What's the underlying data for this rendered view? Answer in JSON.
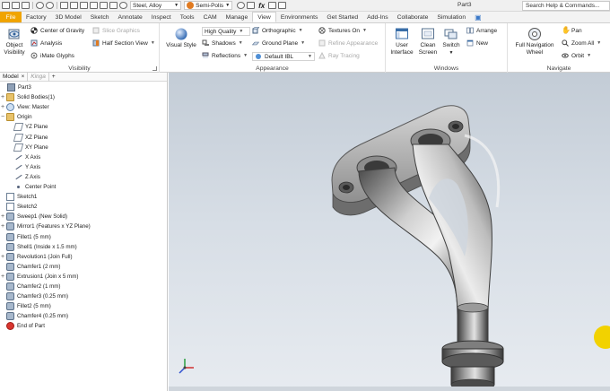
{
  "titlebar": {
    "material": "Steel, Alloy",
    "material_color": "#9aa3ad",
    "appearance": "Semi-Polis",
    "appearance_color": "#e07b22",
    "document_title": "Part3",
    "search_placeholder": "Search Help & Commands..."
  },
  "tabs": [
    "File",
    "Factory",
    "3D Model",
    "Sketch",
    "Annotate",
    "Inspect",
    "Tools",
    "CAM",
    "Manage",
    "View",
    "Environments",
    "Get Started",
    "Add-Ins",
    "Collaborate",
    "Simulation"
  ],
  "active_tab": "View",
  "ribbon": {
    "visibility": {
      "title": "Visibility",
      "object_visibility": "Object Visibility",
      "center_of_gravity": "Center of Gravity",
      "slice_graphics": "Slice Graphics",
      "analysis": "Analysis",
      "half_section_view": "Half Section View",
      "imate_glyphs": "iMate Glyphs"
    },
    "appearance": {
      "title": "Appearance",
      "visual_style": "Visual Style",
      "high_quality": "High Quality",
      "shadows": "Shadows",
      "reflections": "Reflections",
      "orthographic": "Orthographic",
      "ground_plane": "Ground Plane",
      "default_ibl": "Default IBL",
      "textures_on": "Textures On",
      "refine_appearance": "Refine Appearance",
      "ray_tracing": "Ray Tracing"
    },
    "windows": {
      "title": "Windows",
      "user_interface": "User Interface",
      "clean_screen": "Clean Screen",
      "switch": "Switch",
      "arrange": "Arrange",
      "new": "New"
    },
    "navigate": {
      "title": "Navigate",
      "full_navigation_wheel": "Full Navigation Wheel",
      "pan": "Pan",
      "zoom_all": "Zoom All",
      "orbit": "Orbit"
    }
  },
  "browser": {
    "tabs": [
      "Model",
      "Kinga"
    ],
    "plus": "+",
    "items": [
      {
        "label": "Part3",
        "icon": "part-icon",
        "level": 0,
        "expander": ""
      },
      {
        "label": "Solid Bodies(1)",
        "icon": "folder-icon",
        "level": 1,
        "expander": "+"
      },
      {
        "label": "View: Master",
        "icon": "view-icon",
        "level": 1,
        "expander": "+"
      },
      {
        "label": "Origin",
        "icon": "folder-icon",
        "level": 1,
        "expander": "−"
      },
      {
        "label": "YZ Plane",
        "icon": "plane-icon",
        "level": 2,
        "expander": ""
      },
      {
        "label": "XZ Plane",
        "icon": "plane-icon",
        "level": 2,
        "expander": ""
      },
      {
        "label": "XY Plane",
        "icon": "plane-icon",
        "level": 2,
        "expander": ""
      },
      {
        "label": "X Axis",
        "icon": "axis-icon",
        "level": 2,
        "expander": ""
      },
      {
        "label": "Y Axis",
        "icon": "axis-icon",
        "level": 2,
        "expander": ""
      },
      {
        "label": "Z Axis",
        "icon": "axis-icon",
        "level": 2,
        "expander": ""
      },
      {
        "label": "Center Point",
        "icon": "point-icon",
        "level": 2,
        "expander": ""
      },
      {
        "label": "Sketch1",
        "icon": "sketch-icon",
        "level": 1,
        "expander": ""
      },
      {
        "label": "Sketch2",
        "icon": "sketch-icon",
        "level": 1,
        "expander": ""
      },
      {
        "label": "Sweep1 (New Solid)",
        "icon": "sweep-icon",
        "level": 1,
        "expander": "+"
      },
      {
        "label": "Mirror1 (Features x YZ Plane)",
        "icon": "mirror-icon",
        "level": 1,
        "expander": "+"
      },
      {
        "label": "Fillet1 (5 mm)",
        "icon": "fillet-icon",
        "level": 1,
        "expander": ""
      },
      {
        "label": "Shell1 (Inside x 1.5 mm)",
        "icon": "shell-icon",
        "level": 1,
        "expander": ""
      },
      {
        "label": "Revolution1 (Join Full)",
        "icon": "revolve-icon",
        "level": 1,
        "expander": "+"
      },
      {
        "label": "Chamfer1 (2 mm)",
        "icon": "chamfer-icon",
        "level": 1,
        "expander": ""
      },
      {
        "label": "Extrusion1 (Join x 5 mm)",
        "icon": "extrude-icon",
        "level": 1,
        "expander": "+"
      },
      {
        "label": "Chamfer2 (1 mm)",
        "icon": "chamfer-icon",
        "level": 1,
        "expander": ""
      },
      {
        "label": "Chamfer3 (0.25 mm)",
        "icon": "chamfer-icon",
        "level": 1,
        "expander": ""
      },
      {
        "label": "Fillet2 (5 mm)",
        "icon": "fillet-icon",
        "level": 1,
        "expander": ""
      },
      {
        "label": "Chamfer4 (0.25 mm)",
        "icon": "chamfer-icon",
        "level": 1,
        "expander": ""
      },
      {
        "label": "End of Part",
        "icon": "end-of-part-icon",
        "level": 1,
        "expander": ""
      }
    ]
  },
  "colors": {
    "file_tab": "#f0a400",
    "viewport_top": "#c3ccd6",
    "viewport_bottom": "#e7ebf0",
    "cursor_highlight": "#f2d200"
  }
}
